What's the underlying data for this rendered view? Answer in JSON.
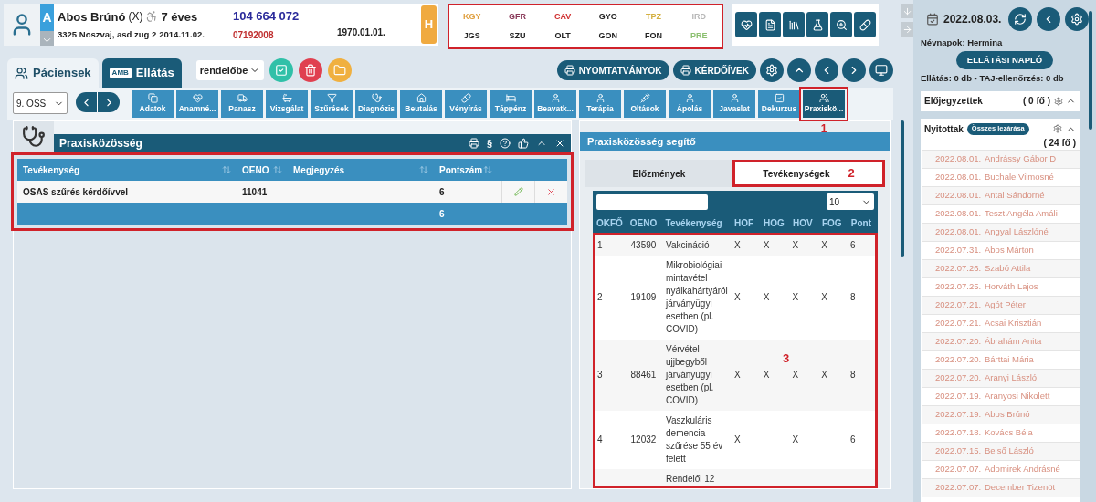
{
  "patient": {
    "initial": "A",
    "name": "Abos Brúnó",
    "marker": "(X)",
    "age": "7 éves",
    "address": "3325 Noszvaj, asd zug 2",
    "birth_date": "2014.11.02.",
    "taj": "104 664 072",
    "code": "07192008",
    "date": "1970.01.01.",
    "flag": "H"
  },
  "lab_codes": {
    "highlighted": true,
    "rows": [
      [
        {
          "label": "KGY",
          "color": "#e0a040"
        },
        {
          "label": "GFR",
          "color": "#8a3a5a"
        },
        {
          "label": "CAV",
          "color": "#d03030"
        },
        {
          "label": "GYO",
          "color": "#222222"
        },
        {
          "label": "TPZ",
          "color": "#d4b040"
        },
        {
          "label": "IRD",
          "color": "#b8b8b8"
        }
      ],
      [
        {
          "label": "JGS",
          "color": "#222222"
        },
        {
          "label": "SZU",
          "color": "#222222"
        },
        {
          "label": "OLT",
          "color": "#222222"
        },
        {
          "label": "GON",
          "color": "#222222"
        },
        {
          "label": "FON",
          "color": "#222222"
        },
        {
          "label": "PRE",
          "color": "#8cc070"
        }
      ]
    ]
  },
  "main_tabs": [
    {
      "label": "Páciensek",
      "selected": true
    },
    {
      "label": "Ellátás",
      "badge": "AMB",
      "selected": false
    }
  ],
  "location_select": {
    "value": "rendelőbe"
  },
  "action_buttons": [
    "NYOMTATVÁNYOK",
    "KÉRDŐÍVEK"
  ],
  "toolbar": {
    "select_value": "9. ÖSS",
    "items": [
      {
        "label": "Adatok",
        "selected": false,
        "highlighted": false
      },
      {
        "label": "Anamné...",
        "selected": false,
        "highlighted": false
      },
      {
        "label": "Panasz",
        "selected": false,
        "highlighted": false
      },
      {
        "label": "Vizsgálat",
        "selected": false,
        "highlighted": false
      },
      {
        "label": "Szűrések",
        "selected": false,
        "highlighted": false
      },
      {
        "label": "Diagnózis",
        "selected": false,
        "highlighted": false
      },
      {
        "label": "Beutalás",
        "selected": false,
        "highlighted": false
      },
      {
        "label": "Vényírás",
        "selected": false,
        "highlighted": false
      },
      {
        "label": "Táppénz",
        "selected": false,
        "highlighted": false
      },
      {
        "label": "Beavatk...",
        "selected": false,
        "highlighted": false
      },
      {
        "label": "Terápia",
        "selected": false,
        "highlighted": false
      },
      {
        "label": "Oltások",
        "selected": false,
        "highlighted": false
      },
      {
        "label": "Ápolás",
        "selected": false,
        "highlighted": false
      },
      {
        "label": "Javaslat",
        "selected": false,
        "highlighted": false
      },
      {
        "label": "Dekurzus",
        "selected": false,
        "highlighted": false
      },
      {
        "label": "Praxiskö...",
        "selected": true,
        "highlighted": true,
        "marker": "1"
      }
    ]
  },
  "left_panel": {
    "title": "Praxisközösség",
    "section_symbol": "§",
    "table": {
      "highlighted": true,
      "columns": [
        "Tevékenység",
        "OENO",
        "Megjegyzés",
        "Pontszám"
      ],
      "rows": [
        {
          "activity": "OSAS szűrés kérdőívvel",
          "oeno": "11041",
          "note": "",
          "points": "6"
        }
      ],
      "total": "6"
    }
  },
  "right_panel": {
    "title": "Praxisközösség segítő",
    "tabs": [
      {
        "label": "Előzmények",
        "selected": false,
        "highlighted": false
      },
      {
        "label": "Tevékenységek",
        "selected": true,
        "highlighted": true,
        "marker": "2"
      }
    ],
    "page_size": "10",
    "table": {
      "highlighted": true,
      "marker": "3",
      "columns": [
        "OKFŐ",
        "OENO",
        "Tevékenység",
        "HOF",
        "HOG",
        "HOV",
        "FOG",
        "Pont"
      ],
      "rows": [
        [
          "1",
          "43590",
          "Vakcináció",
          "X",
          "X",
          "X",
          "X",
          "6"
        ],
        [
          "2",
          "19109",
          "Mikrobiológiai mintavétel nyálkahártyáról járványügyi esetben (pl. COVID)",
          "X",
          "X",
          "X",
          "X",
          "8"
        ],
        [
          "3",
          "88461",
          "Vérvétel ujjbegyből járványügyi esetben (pl. COVID)",
          "X",
          "X",
          "X",
          "X",
          "8"
        ],
        [
          "4",
          "12032",
          "Vaszkuláris demencia szűrése 55 év felett",
          "X",
          "",
          "X",
          "",
          "6"
        ],
        [
          "",
          "",
          "Rendelői 12",
          "",
          "",
          "",
          "",
          ""
        ]
      ]
    }
  },
  "sidebar": {
    "date": "2022.08.03.",
    "namedays": "Névnapok: Hermina",
    "log_button": "ELLÁTÁSI NAPLÓ",
    "summary": "Ellátás: 0 db - TAJ-ellenőrzés: 0 db",
    "scheduled": {
      "title": "Előjegyzettek",
      "count": "( 0 fő )"
    },
    "open": {
      "title": "Nyitottak",
      "close_all": "Összes lezárása",
      "count": "( 24 fő )",
      "rows": [
        {
          "date": "2022.08.01.",
          "name": "Andrássy Gábor D"
        },
        {
          "date": "2022.08.01.",
          "name": "Buchale Vilmosné"
        },
        {
          "date": "2022.08.01.",
          "name": "Antal Sándorné"
        },
        {
          "date": "2022.08.01.",
          "name": "Teszt Angéla Amáli"
        },
        {
          "date": "2022.08.01.",
          "name": "Angyal Lászlóné"
        },
        {
          "date": "2022.07.31.",
          "name": "Abos Márton"
        },
        {
          "date": "2022.07.26.",
          "name": "Szabó Attila"
        },
        {
          "date": "2022.07.25.",
          "name": "Horváth Lajos"
        },
        {
          "date": "2022.07.21.",
          "name": "Agót Péter"
        },
        {
          "date": "2022.07.21.",
          "name": "Acsai Krisztián"
        },
        {
          "date": "2022.07.20.",
          "name": "Ábrahám Anita"
        },
        {
          "date": "2022.07.20.",
          "name": "Bárttai Mária"
        },
        {
          "date": "2022.07.20.",
          "name": "Aranyi László"
        },
        {
          "date": "2022.07.19.",
          "name": "Aranyosi Nikolett"
        },
        {
          "date": "2022.07.19.",
          "name": "Abos Brúnó"
        },
        {
          "date": "2022.07.18.",
          "name": "Kovács Béla"
        },
        {
          "date": "2022.07.15.",
          "name": "Belső László"
        },
        {
          "date": "2022.07.07.",
          "name": "Adomirek Andrásné"
        },
        {
          "date": "2022.07.07.",
          "name": "December Tizenöt"
        }
      ]
    }
  }
}
